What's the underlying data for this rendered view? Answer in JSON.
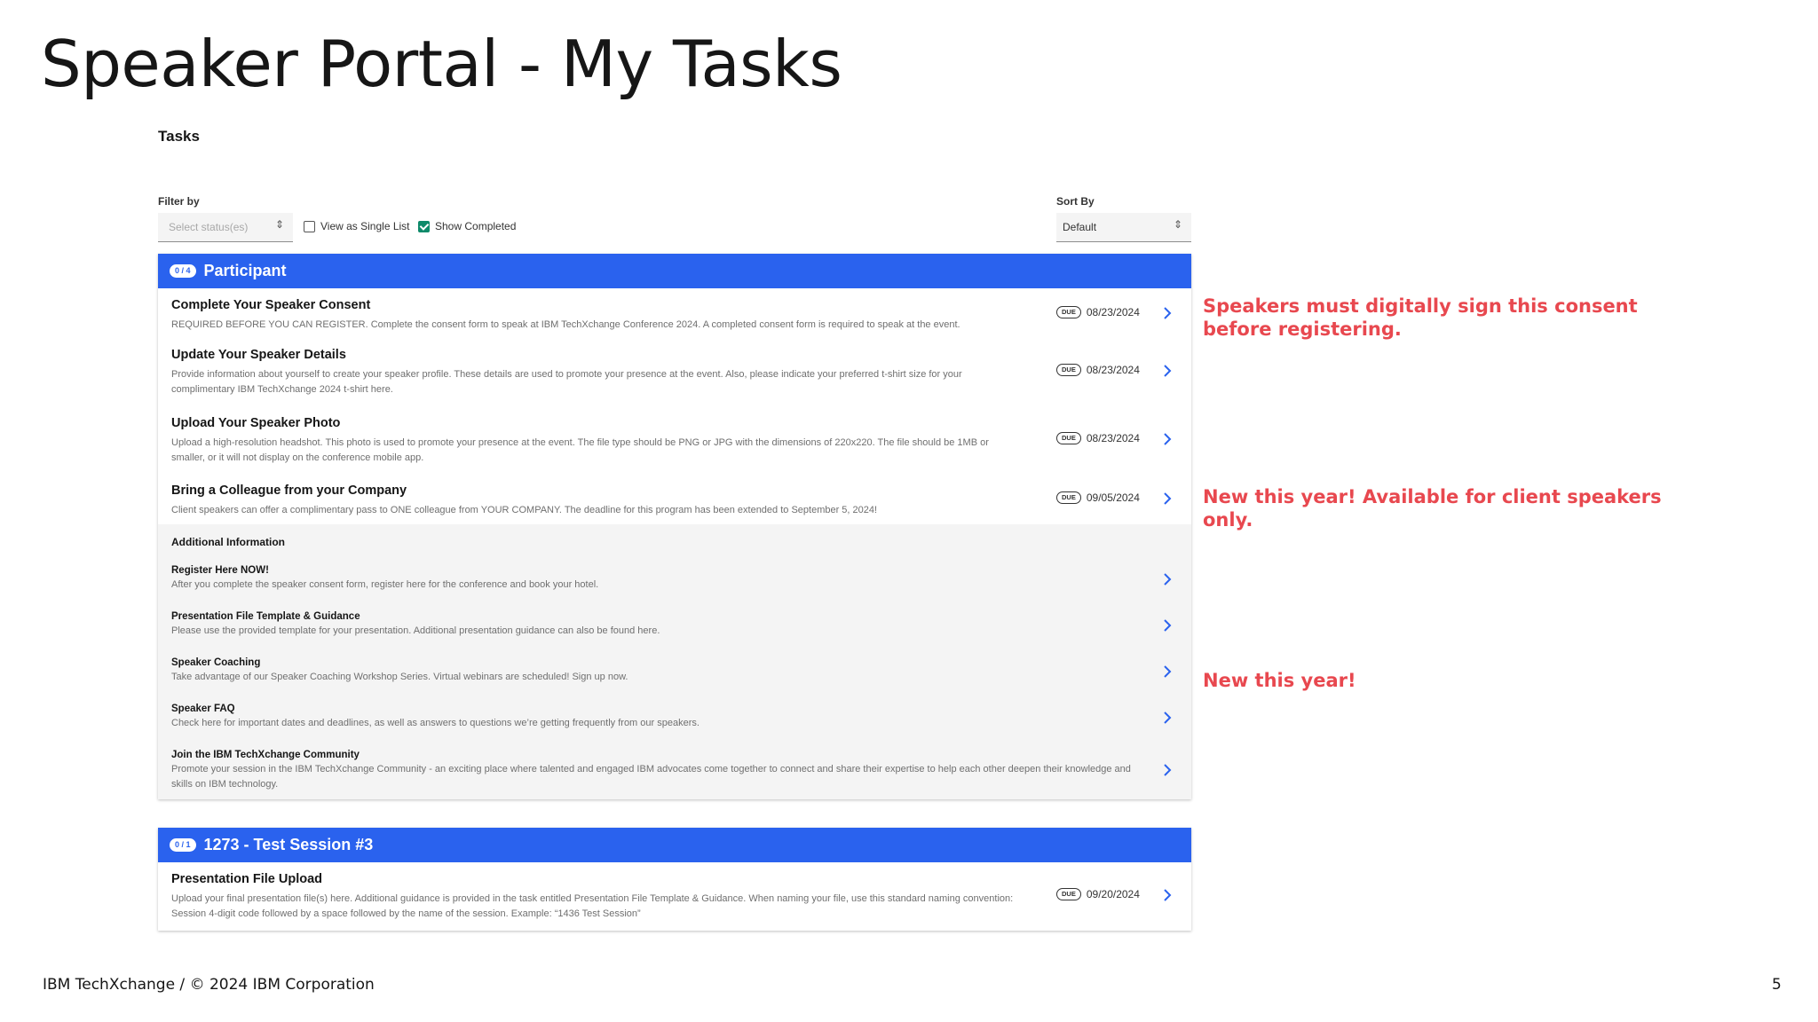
{
  "slide": {
    "title": "Speaker Portal - My Tasks",
    "footer": "IBM TechXchange / © 2024 IBM Corporation",
    "page_number": "5"
  },
  "colors": {
    "accent_blue": "#2a62ee",
    "annotation_red": "#e8484f",
    "checkbox_green": "#0e8a6a"
  },
  "toolbar": {
    "heading": "Tasks",
    "filter_label": "Filter by",
    "status_placeholder": "Select status(es)",
    "single_list_label": "View as Single List",
    "single_list_checked": false,
    "show_completed_label": "Show Completed",
    "show_completed_checked": true,
    "sort_label": "Sort By",
    "sort_value": "Default"
  },
  "participant": {
    "count": "0 / 4",
    "title": "Participant",
    "tasks": [
      {
        "title": "Complete Your Speaker Consent",
        "desc": "REQUIRED BEFORE YOU CAN REGISTER. Complete the consent form to speak at IBM TechXchange Conference 2024. A completed consent form is required to speak at the event.",
        "due_badge": "DUE",
        "due": "08/23/2024"
      },
      {
        "title": "Update Your Speaker Details",
        "desc": "Provide information about yourself to create your speaker profile. These details are used to promote your presence at the event. Also, please indicate your preferred t-shirt size for your complimentary IBM TechXchange 2024 t-shirt here.",
        "due_badge": "DUE",
        "due": "08/23/2024"
      },
      {
        "title": "Upload Your Speaker Photo",
        "desc": "Upload a high-resolution headshot. This photo is used to promote your presence at the event. The file type should be PNG or JPG with the dimensions of 220x220. The file should be 1MB or smaller, or it will not display on the conference mobile app.",
        "due_badge": "DUE",
        "due": "08/23/2024"
      },
      {
        "title": "Bring a Colleague from your Company",
        "desc": "Client speakers can offer a complimentary pass to ONE colleague from YOUR COMPANY. The deadline for this program has been extended to September 5, 2024!",
        "due_badge": "DUE",
        "due": "09/05/2024"
      }
    ],
    "additional_heading": "Additional Information",
    "additional": [
      {
        "title": "Register Here NOW!",
        "desc": "After you complete the speaker consent form, register here for the conference and book your hotel."
      },
      {
        "title": "Presentation File Template & Guidance",
        "desc": "Please use the provided template for your presentation. Additional presentation guidance can also be found here."
      },
      {
        "title": "Speaker Coaching",
        "desc": "Take advantage of our Speaker Coaching Workshop Series. Virtual webinars are scheduled! Sign up now."
      },
      {
        "title": "Speaker FAQ",
        "desc": "Check here for important dates and deadlines, as well as answers to questions we’re getting frequently from our speakers."
      },
      {
        "title": "Join the IBM TechXchange Community",
        "desc": "Promote your session in the IBM TechXchange Community - an exciting place where talented and engaged IBM advocates come together to connect and share their expertise to help each other deepen their knowledge and skills on IBM technology."
      }
    ]
  },
  "session": {
    "count": "0 / 1",
    "title": "1273 - Test Session #3",
    "tasks": [
      {
        "title": "Presentation File Upload",
        "desc": "Upload your final presentation file(s) here. Additional guidance is provided in the task entitled Presentation File Template & Guidance. When naming your file, use this standard naming convention:  Session 4-digit code followed by a space followed by the name of the session. Example: “1436 Test Session”",
        "due_badge": "DUE",
        "due": "09/20/2024"
      }
    ]
  },
  "annotations": {
    "consent": "Speakers must digitally sign this consent before registering.",
    "colleague": "New this year! Available for client speakers only.",
    "coaching": "New this year!"
  }
}
